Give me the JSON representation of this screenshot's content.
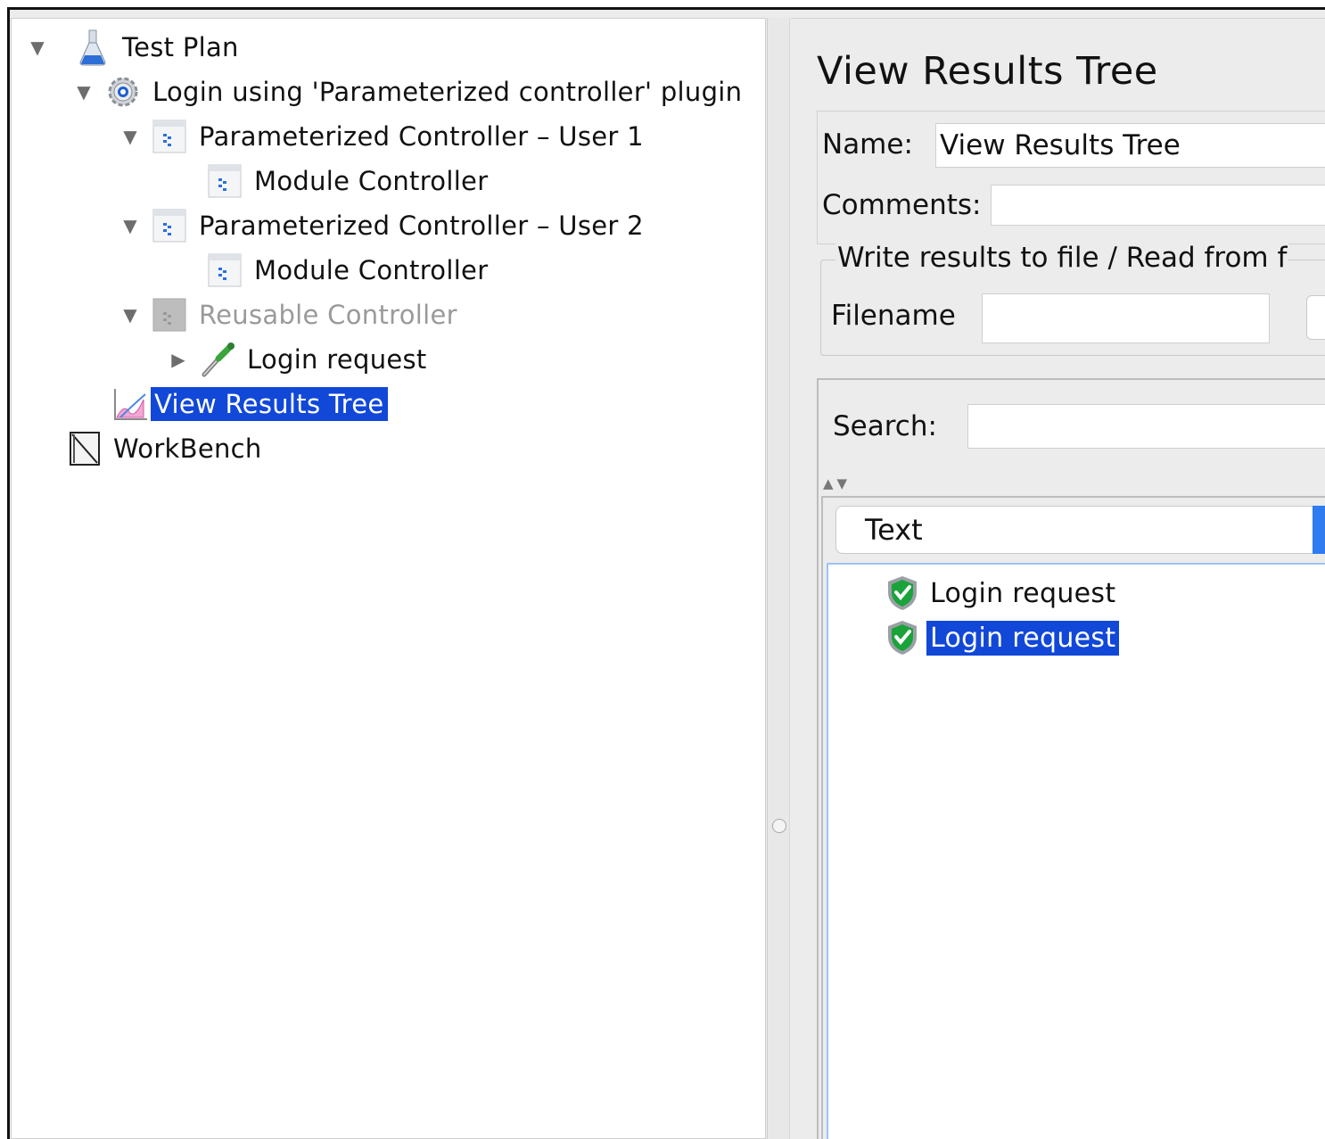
{
  "tree": {
    "nodes": [
      {
        "label": "Test Plan",
        "icon": "flask-icon"
      },
      {
        "label": "Login using 'Parameterized controller' plugin",
        "icon": "gear-icon"
      },
      {
        "label": "Parameterized Controller – User 1",
        "icon": "controller-icon"
      },
      {
        "label": "Module Controller",
        "icon": "controller-icon"
      },
      {
        "label": "Parameterized Controller – User 2",
        "icon": "controller-icon"
      },
      {
        "label": "Module Controller",
        "icon": "controller-icon"
      },
      {
        "label": "Reusable Controller",
        "icon": "controller-icon",
        "disabled": true
      },
      {
        "label": "Login request",
        "icon": "pipette-icon"
      },
      {
        "label": "View Results Tree",
        "icon": "graph-icon",
        "selected": true
      },
      {
        "label": "WorkBench",
        "icon": "workbench-icon"
      }
    ]
  },
  "panel": {
    "title": "View Results Tree",
    "name_label": "Name:",
    "name_value": "View Results Tree",
    "comments_label": "Comments:",
    "comments_value": "",
    "file_group_title": "Write results to file / Read from f",
    "filename_label": "Filename",
    "filename_value": "",
    "search_label": "Search:",
    "search_value": "",
    "renderer_selected": "Text",
    "results": [
      {
        "label": "Login request",
        "status": "success"
      },
      {
        "label": "Login request",
        "status": "success",
        "selected": true
      }
    ]
  },
  "colors": {
    "selection": "#1148d8",
    "success": "#1aa33a",
    "accent": "#2f7bf0"
  }
}
